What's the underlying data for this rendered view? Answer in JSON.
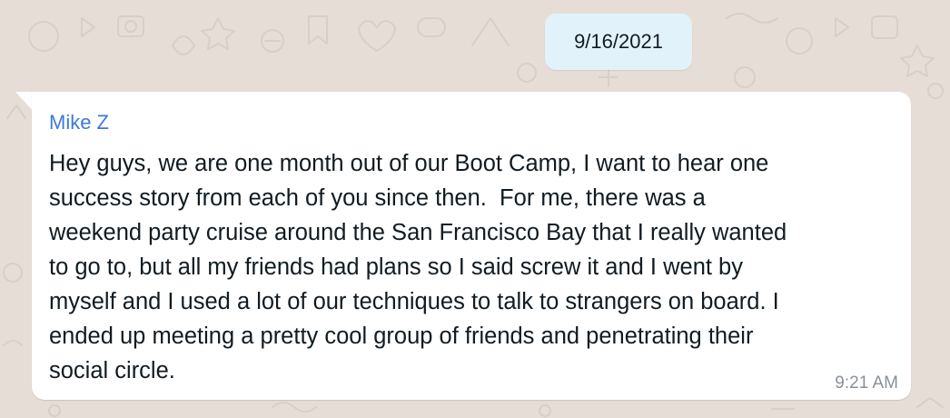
{
  "date_divider": {
    "label": "9/16/2021"
  },
  "message": {
    "sender": "Mike Z",
    "text": "Hey guys, we are one month out of our Boot Camp, I want to hear one\nsuccess story from each of you since then.  For me, there was a\nweekend party cruise around the San Francisco Bay that I really wanted\nto go to, but all my friends had plans so I said screw it and I went by\nmyself and I used a lot of our techniques to talk to strangers on board. I\nended up meeting a pretty cool group of friends and penetrating their\nsocial circle.",
    "time": "9:21 AM"
  },
  "colors": {
    "chat_background": "#e6ded6",
    "date_chip_background": "#e1f2fb",
    "sender_name": "#3b7ad9",
    "timestamp": "#8a9197"
  }
}
